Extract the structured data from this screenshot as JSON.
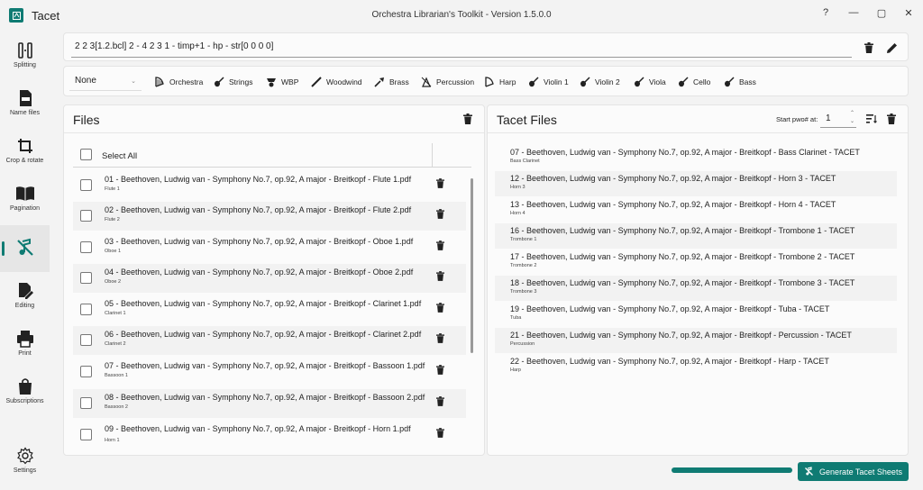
{
  "app": {
    "name": "Tacet",
    "window_title": "Orchestra Librarian's Toolkit - Version 1.5.0.0",
    "controls": {
      "help": "?",
      "minimize": "—",
      "maximize": "▢",
      "close": "✕"
    }
  },
  "sidebar": {
    "items": [
      {
        "label": "Splitting",
        "icon": "splitting-icon"
      },
      {
        "label": "Name files",
        "icon": "name-files-icon"
      },
      {
        "label": "Crop & rotate",
        "icon": "crop-rotate-icon"
      },
      {
        "label": "Pagination",
        "icon": "book-icon"
      },
      {
        "label": "",
        "icon": "tacet-icon",
        "active": true
      },
      {
        "label": "Editing",
        "icon": "edit-icon"
      },
      {
        "label": "Print",
        "icon": "printer-icon"
      },
      {
        "label": "Subscriptions",
        "icon": "shopping-bag-icon"
      },
      {
        "label": "Settings",
        "icon": "gear-icon"
      }
    ]
  },
  "formula": {
    "value": "2 2 3[1.2.bcl] 2 - 4 2 3 1 - timp+1 - hp - str[0 0 0 0]"
  },
  "toolbar": {
    "preset": "None",
    "instruments": [
      "Orchestra",
      "Strings",
      "WBP",
      "Woodwind",
      "Brass",
      "Percussion",
      "Harp",
      "Violin 1",
      "Violin 2",
      "Viola",
      "Cello",
      "Bass"
    ]
  },
  "files_panel": {
    "title": "Files",
    "select_all": "Select All",
    "rows": [
      {
        "name": "01 - Beethoven, Ludwig van - Symphony No.7, op.92, A major - Breitkopf - Flute 1.pdf",
        "sub": "Flute 1"
      },
      {
        "name": "02 - Beethoven, Ludwig van - Symphony No.7, op.92, A major - Breitkopf - Flute 2.pdf",
        "sub": "Flute 2"
      },
      {
        "name": "03 - Beethoven, Ludwig van - Symphony No.7, op.92, A major - Breitkopf - Oboe 1.pdf",
        "sub": "Oboe 1"
      },
      {
        "name": "04 - Beethoven, Ludwig van - Symphony No.7, op.92, A major - Breitkopf - Oboe 2.pdf",
        "sub": "Oboe 2"
      },
      {
        "name": "05 - Beethoven, Ludwig van - Symphony No.7, op.92, A major - Breitkopf - Clarinet 1.pdf",
        "sub": "Clarinet 1"
      },
      {
        "name": "06 - Beethoven, Ludwig van - Symphony No.7, op.92, A major - Breitkopf - Clarinet 2.pdf",
        "sub": "Clarinet 2"
      },
      {
        "name": "07 - Beethoven, Ludwig van - Symphony No.7, op.92, A major - Breitkopf - Bassoon 1.pdf",
        "sub": "Bassoon 1"
      },
      {
        "name": "08 - Beethoven, Ludwig van - Symphony No.7, op.92, A major - Breitkopf - Bassoon 2.pdf",
        "sub": "Bassoon 2"
      },
      {
        "name": "09 - Beethoven, Ludwig van - Symphony No.7, op.92, A major - Breitkopf - Horn 1.pdf",
        "sub": "Horn 1"
      }
    ]
  },
  "tacet_panel": {
    "title": "Tacet Files",
    "start_label": "Start pwo# at:",
    "start_value": "1",
    "rows": [
      {
        "name": "07 - Beethoven, Ludwig van - Symphony No.7, op.92, A major - Breitkopf - Bass Clarinet - TACET",
        "sub": "Bass Clarinet"
      },
      {
        "name": "12 - Beethoven, Ludwig van - Symphony No.7, op.92, A major - Breitkopf - Horn 3 - TACET",
        "sub": "Horn 3"
      },
      {
        "name": "13 - Beethoven, Ludwig van - Symphony No.7, op.92, A major - Breitkopf - Horn 4 - TACET",
        "sub": "Horn 4"
      },
      {
        "name": "16 - Beethoven, Ludwig van - Symphony No.7, op.92, A major - Breitkopf - Trombone 1 - TACET",
        "sub": "Trombone 1"
      },
      {
        "name": "17 - Beethoven, Ludwig van - Symphony No.7, op.92, A major - Breitkopf - Trombone 2 - TACET",
        "sub": "Trombone 2"
      },
      {
        "name": "18 - Beethoven, Ludwig van - Symphony No.7, op.92, A major - Breitkopf - Trombone 3 - TACET",
        "sub": "Trombone 3"
      },
      {
        "name": "19 - Beethoven, Ludwig van - Symphony No.7, op.92, A major - Breitkopf - Tuba - TACET",
        "sub": "Tuba"
      },
      {
        "name": "21 - Beethoven, Ludwig van - Symphony No.7, op.92, A major - Breitkopf - Percussion - TACET",
        "sub": "Percussion"
      },
      {
        "name": "22 - Beethoven, Ludwig van - Symphony No.7, op.92, A major - Breitkopf - Harp - TACET",
        "sub": "Harp"
      }
    ]
  },
  "footer": {
    "generate_label": "Generate Tacet Sheets"
  },
  "colors": {
    "accent": "#0f7b73"
  }
}
